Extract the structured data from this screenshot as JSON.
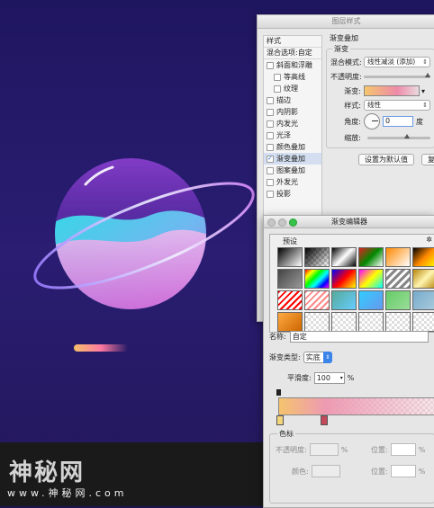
{
  "layer_style": {
    "title": "图层样式",
    "styles_header": "样式",
    "blend_options": "混合选项:自定",
    "effects": [
      {
        "label": "斜面和浮雕",
        "checked": false,
        "indent": false,
        "selected": false
      },
      {
        "label": "等高线",
        "checked": false,
        "indent": true,
        "selected": false
      },
      {
        "label": "纹理",
        "checked": false,
        "indent": true,
        "selected": false
      },
      {
        "label": "描边",
        "checked": false,
        "indent": false,
        "selected": false
      },
      {
        "label": "内阴影",
        "checked": false,
        "indent": false,
        "selected": false
      },
      {
        "label": "内发光",
        "checked": false,
        "indent": false,
        "selected": false
      },
      {
        "label": "光泽",
        "checked": false,
        "indent": false,
        "selected": false
      },
      {
        "label": "颜色叠加",
        "checked": false,
        "indent": false,
        "selected": false
      },
      {
        "label": "渐变叠加",
        "checked": true,
        "indent": false,
        "selected": true
      },
      {
        "label": "图案叠加",
        "checked": false,
        "indent": false,
        "selected": false
      },
      {
        "label": "外发光",
        "checked": false,
        "indent": false,
        "selected": false
      },
      {
        "label": "投影",
        "checked": false,
        "indent": false,
        "selected": false
      }
    ],
    "panel_title": "渐变叠加",
    "group_title": "渐变",
    "blend_mode_label": "混合模式:",
    "blend_mode_value": "线性减淡 (添加)",
    "opacity_label": "不透明度:",
    "gradient_label": "渐变:",
    "style_label": "样式:",
    "style_value": "线性",
    "angle_label": "角度:",
    "angle_value": "0",
    "angle_unit": "度",
    "scale_label": "缩放:",
    "reset_button": "设置为默认值",
    "restore_button": "复位"
  },
  "gradient_editor": {
    "title": "渐变编辑器",
    "presets_label": "预设",
    "name_label": "名称:",
    "name_value": "自定",
    "type_label": "渐变类型:",
    "type_value": "实底",
    "smoothness_label": "平滑度:",
    "smoothness_value": "100",
    "smoothness_unit": "%",
    "color_stops_label": "色标",
    "opacity_label": "不透明度:",
    "opacity_unit": "%",
    "color_label": "颜色:",
    "location_label": "位置:",
    "location_unit": "%",
    "location_label_2": "位置:",
    "location_unit_2": "%"
  },
  "watermark": {
    "text": "神秘网",
    "subtext": "www.神秘网.com"
  }
}
